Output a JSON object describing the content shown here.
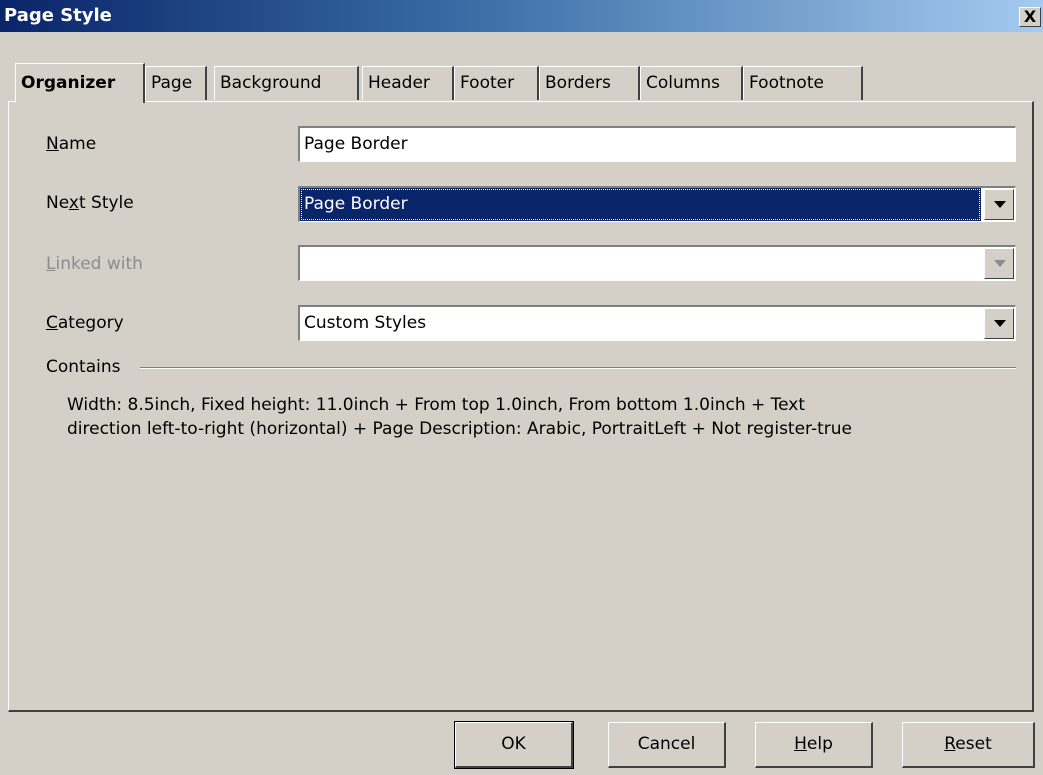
{
  "window": {
    "title": "Page Style",
    "close_label": "X"
  },
  "tabs": [
    {
      "label": "Organizer",
      "active": true
    },
    {
      "label": "Page"
    },
    {
      "label": "Background"
    },
    {
      "label": "Header"
    },
    {
      "label": "Footer"
    },
    {
      "label": "Borders"
    },
    {
      "label": "Columns"
    },
    {
      "label": "Footnote"
    }
  ],
  "form": {
    "name": {
      "label_first": "N",
      "label_rest": "ame",
      "value": "Page Border"
    },
    "next_style": {
      "label_first": "Ne",
      "label_mid": "x",
      "label_rest": "t Style",
      "value": "Page Border"
    },
    "linked_with": {
      "label_first": "L",
      "label_rest": "inked with",
      "value": ""
    },
    "category": {
      "label_first": "C",
      "label_rest": "ategory",
      "value": "Custom Styles"
    }
  },
  "contains": {
    "label": "Contains",
    "line1": "Width: 8.5inch, Fixed height: 11.0inch + From top 1.0inch, From bottom 1.0inch + Text",
    "line2": "direction left-to-right (horizontal) + Page Description: Arabic, PortraitLeft + Not register-true"
  },
  "buttons": {
    "ok": "OK",
    "cancel": "Cancel",
    "help_first": "H",
    "help_rest": "elp",
    "reset_first": "R",
    "reset_rest": "eset"
  }
}
